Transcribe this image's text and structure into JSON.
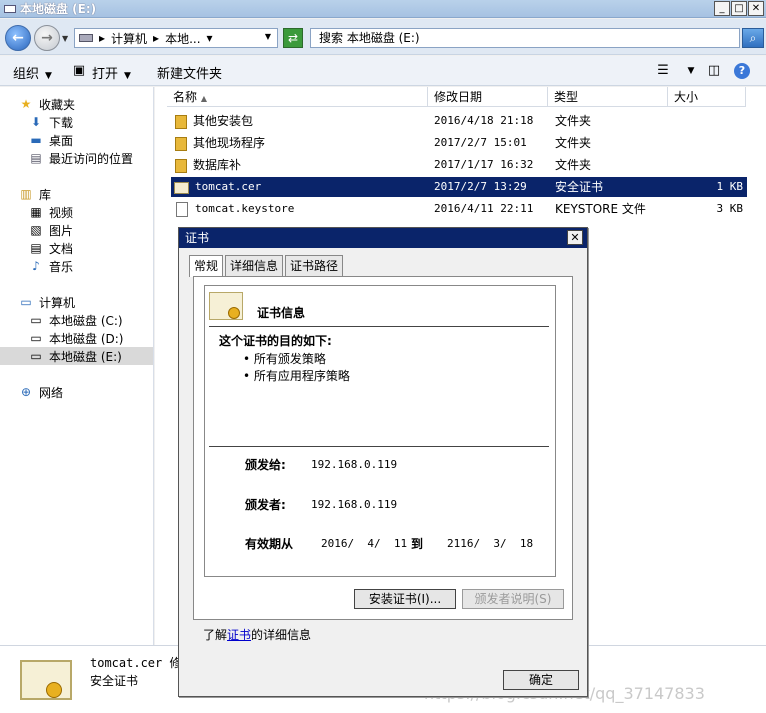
{
  "window": {
    "title": "本地磁盘 (E:)"
  },
  "address": {
    "segments": [
      "计算机",
      "本地...",
      "▾"
    ],
    "search_placeholder": "搜索 本地磁盘 (E:)"
  },
  "toolbar": {
    "organize": "组织",
    "open": "打开",
    "new_folder": "新建文件夹"
  },
  "nav": {
    "favorites": "收藏夹",
    "downloads": "下载",
    "desktop": "桌面",
    "recent": "最近访问的位置",
    "libraries": "库",
    "videos": "视频",
    "pictures": "图片",
    "documents": "文档",
    "music": "音乐",
    "computer": "计算机",
    "drive_c": "本地磁盘 (C:)",
    "drive_d": "本地磁盘 (D:)",
    "drive_e": "本地磁盘 (E:)",
    "network": "网络"
  },
  "columns": {
    "name": "名称",
    "modified": "修改日期",
    "type": "类型",
    "size": "大小"
  },
  "files": [
    {
      "name": "其他安装包",
      "modified": "2016/4/18 21:18",
      "type": "文件夹",
      "size": ""
    },
    {
      "name": "其他现场程序",
      "modified": "2017/2/7 15:01",
      "type": "文件夹",
      "size": ""
    },
    {
      "name": "数据库补",
      "modified": "2017/1/17 16:32",
      "type": "文件夹",
      "size": ""
    },
    {
      "name": "tomcat.cer",
      "modified": "2017/2/7 13:29",
      "type": "安全证书",
      "size": "1 KB"
    },
    {
      "name": "tomcat.keystore",
      "modified": "2016/4/11 22:11",
      "type": "KEYSTORE 文件",
      "size": "3 KB"
    }
  ],
  "details": {
    "name": "tomcat.cer 修",
    "type": "安全证书"
  },
  "dialog": {
    "title": "证书",
    "tabs": [
      "常规",
      "详细信息",
      "证书路径"
    ],
    "cert_info_title": "证书信息",
    "purpose_heading": "这个证书的目的如下:",
    "purposes": [
      "• 所有颁发策略",
      "• 所有应用程序策略"
    ],
    "issued_to_label": "颁发给:",
    "issued_to": "192.168.0.119",
    "issued_by_label": "颁发者:",
    "issued_by": "192.168.0.119",
    "valid_from_label": "有效期从",
    "valid_from": "2016/  4/  11",
    "valid_to_label": "到",
    "valid_to": "2116/  3/  18",
    "install_button": "安装证书(I)...",
    "issuer_statement_button": "颁发者说明(S)",
    "learn_prefix": "了解",
    "learn_link": "证书",
    "learn_suffix": "的详细信息",
    "ok_button": "确定"
  },
  "watermark": "https://blog.csdn.net/qq_37147833"
}
